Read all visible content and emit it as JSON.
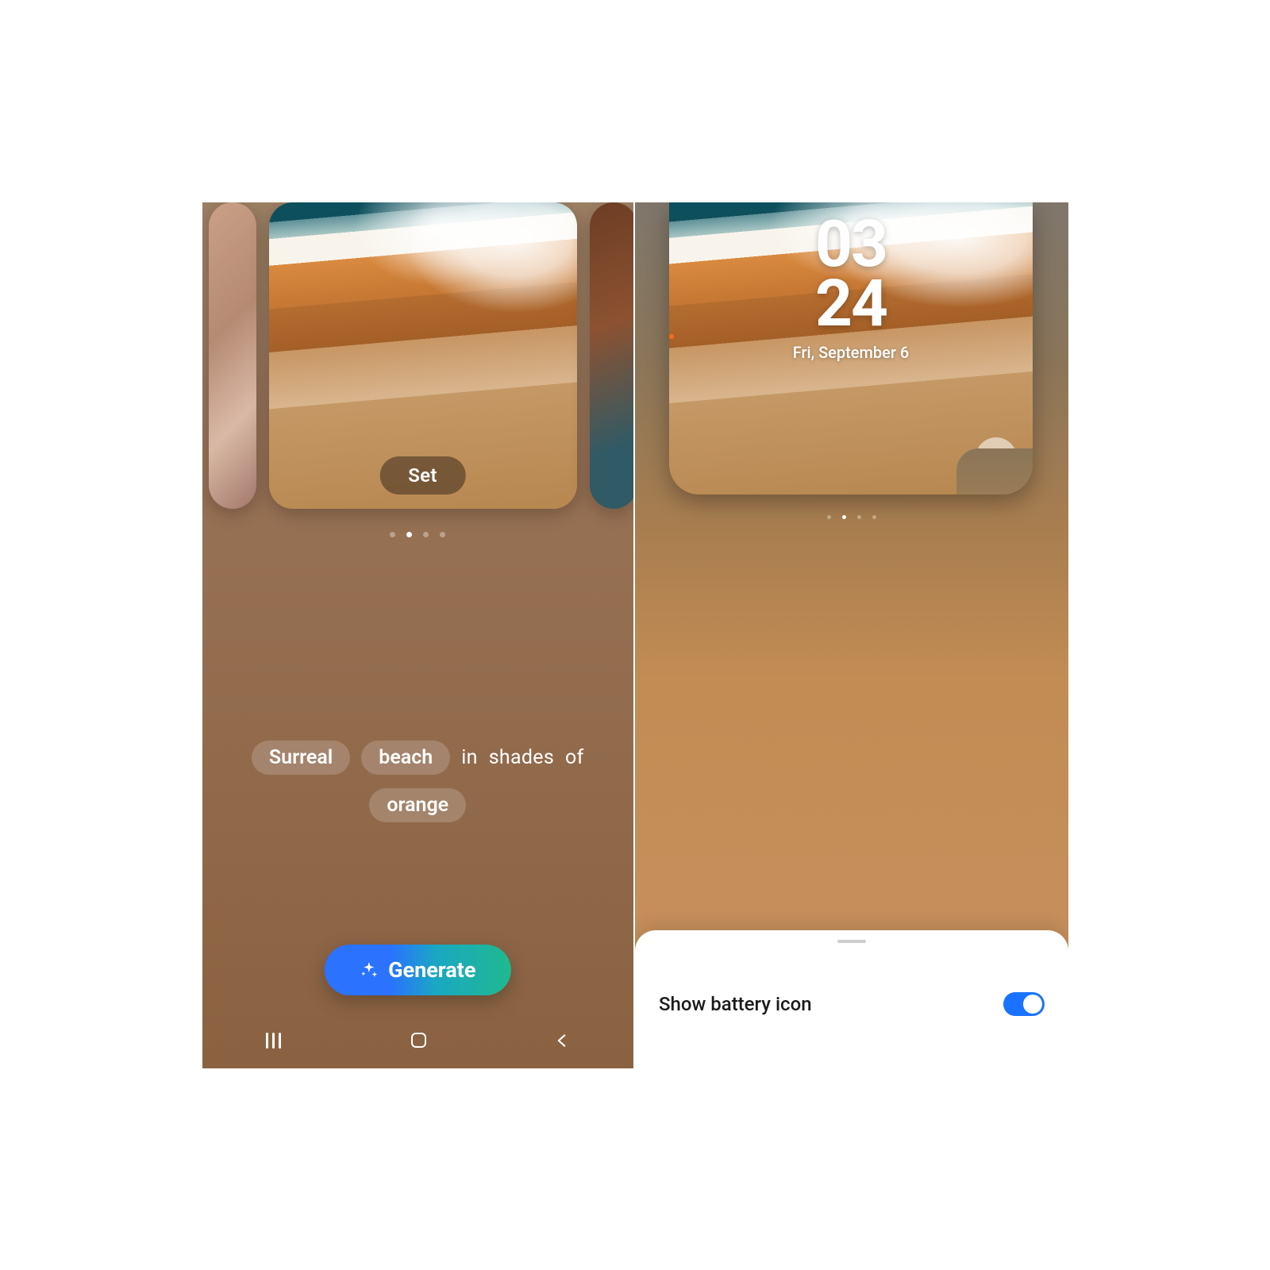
{
  "left": {
    "set_button": "Set",
    "dots": {
      "count": 4,
      "active": 1
    },
    "prompt": {
      "chip_style": "Surreal",
      "chip_subject": "beach",
      "word_in": "in",
      "word_shades": "shades",
      "word_of": "of",
      "chip_color": "orange"
    },
    "generate_label": "Generate"
  },
  "right": {
    "clock": {
      "hours": "03",
      "minutes": "24",
      "date": "Fri, September 6"
    },
    "dots": {
      "count": 4,
      "active": 1
    },
    "sheet": {
      "option_label": "Show battery icon",
      "toggle_on": true
    }
  }
}
